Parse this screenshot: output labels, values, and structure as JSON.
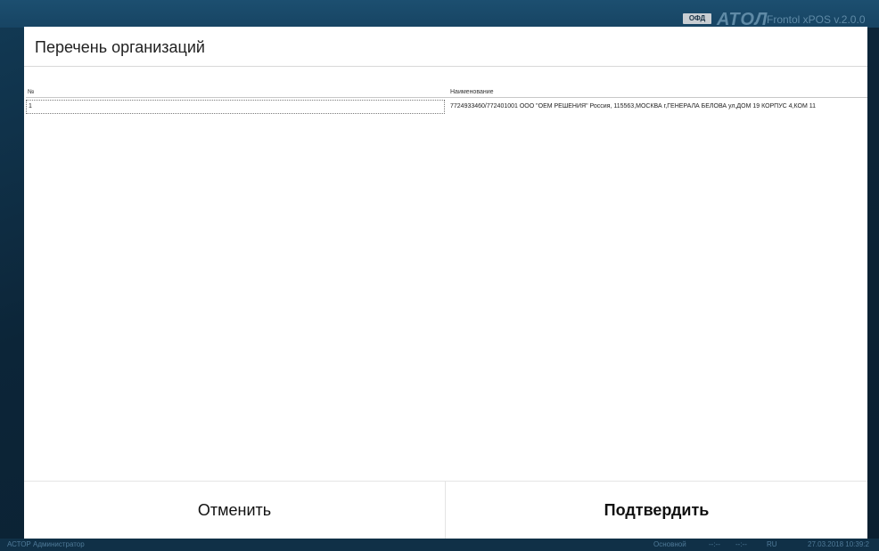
{
  "topbar": {
    "ofd_badge": "ОФД",
    "brand": "АТОЛ",
    "version": "Frontol xPOS v.2.0.0"
  },
  "dialog": {
    "title": "Перечень организаций",
    "table": {
      "columns": [
        "№",
        "Наименование"
      ],
      "rows": [
        {
          "num": "1",
          "name": "7724933460/772401001 ООО \"ОЕМ РЕШЕНИЯ\" Россия, 115563,МОСКВА г,ГЕНЕРАЛА БЕЛОВА ул,ДОМ 19 КОРПУС 4,КОМ 11"
        }
      ]
    },
    "buttons": {
      "cancel": "Отменить",
      "confirm": "Подтвердить"
    }
  },
  "statusbar": {
    "user": "АСТОР  Администратор",
    "mode": "Основной",
    "time1": "--:--",
    "time2": "--:--",
    "lang": "RU",
    "datetime": "27.03.2018 10:39:2"
  }
}
